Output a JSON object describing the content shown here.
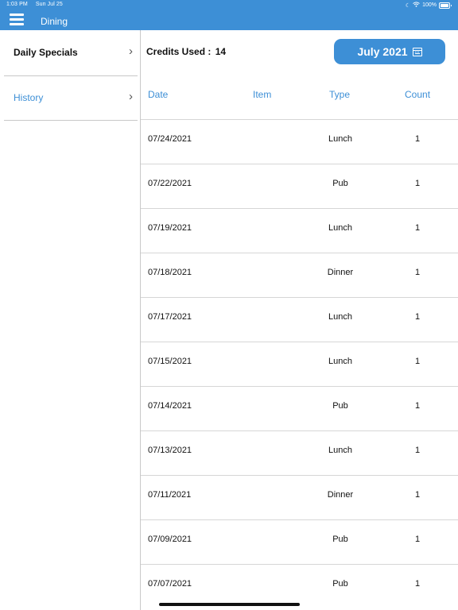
{
  "status": {
    "time": "1:03 PM",
    "date": "Sun Jul 25",
    "battery": "100%"
  },
  "nav": {
    "title": "Dining"
  },
  "sidebar": {
    "items": [
      {
        "label": "Daily Specials"
      },
      {
        "label": "History"
      }
    ]
  },
  "summary": {
    "credits_label": "Credits Used :",
    "credits_value": "14",
    "month_label": "July 2021"
  },
  "table": {
    "headers": {
      "date": "Date",
      "item": "Item",
      "type": "Type",
      "count": "Count"
    },
    "rows": [
      {
        "date": "07/24/2021",
        "type": "Lunch",
        "count": "1"
      },
      {
        "date": "07/22/2021",
        "type": "Pub",
        "count": "1"
      },
      {
        "date": "07/19/2021",
        "type": "Lunch",
        "count": "1"
      },
      {
        "date": "07/18/2021",
        "type": "Dinner",
        "count": "1"
      },
      {
        "date": "07/17/2021",
        "type": "Lunch",
        "count": "1"
      },
      {
        "date": "07/15/2021",
        "type": "Lunch",
        "count": "1"
      },
      {
        "date": "07/14/2021",
        "type": "Pub",
        "count": "1"
      },
      {
        "date": "07/13/2021",
        "type": "Lunch",
        "count": "1"
      },
      {
        "date": "07/11/2021",
        "type": "Dinner",
        "count": "1"
      },
      {
        "date": "07/09/2021",
        "type": "Pub",
        "count": "1"
      },
      {
        "date": "07/07/2021",
        "type": "Pub",
        "count": "1"
      }
    ]
  },
  "colors": {
    "accent": "#3d8fd6",
    "divider": "#d6d6d6"
  }
}
